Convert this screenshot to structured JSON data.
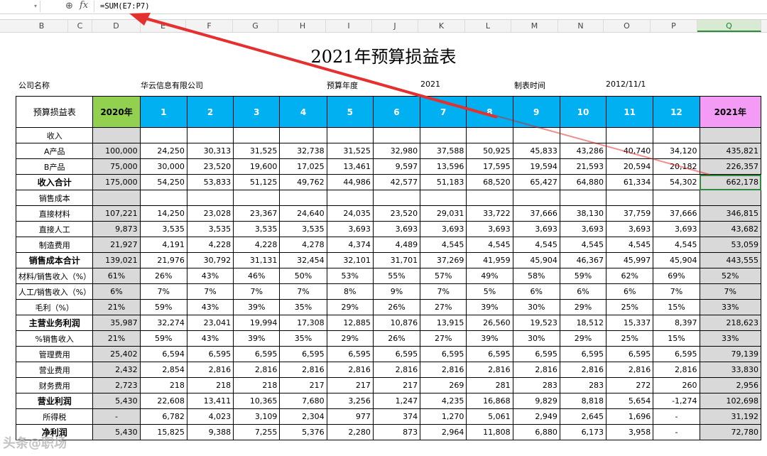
{
  "formula_bar": {
    "formula": "=SUM(E7:P7)"
  },
  "columns": [
    "B",
    "C",
    "D",
    "E",
    "F",
    "G",
    "H",
    "I",
    "J",
    "K",
    "L",
    "M",
    "N",
    "O",
    "P",
    "Q"
  ],
  "title": "2021年预算损益表",
  "info": {
    "company_label": "公司名称",
    "company_value": "华云信息有限公司",
    "year_label": "预算年度",
    "year_value": "2021",
    "date_label": "制表时间",
    "date_value": "2012/11/1"
  },
  "header": {
    "label": "预算损益表",
    "prev_year": "2020年",
    "months": [
      "1",
      "2",
      "3",
      "4",
      "5",
      "6",
      "7",
      "8",
      "9",
      "10",
      "11",
      "12"
    ],
    "next_year": "2021年"
  },
  "rows": [
    {
      "label": "收入",
      "bold": false,
      "values": [
        "",
        "",
        "",
        "",
        "",
        "",
        "",
        "",
        "",
        "",
        "",
        "",
        "",
        ""
      ]
    },
    {
      "label": "A产品",
      "bold": false,
      "values": [
        "100,000",
        "24,250",
        "30,313",
        "31,525",
        "32,738",
        "31,525",
        "32,980",
        "37,588",
        "50,925",
        "45,833",
        "43,286",
        "40,740",
        "34,120",
        "435,821"
      ]
    },
    {
      "label": "B产品",
      "bold": false,
      "values": [
        "75,000",
        "30,000",
        "23,520",
        "19,600",
        "17,025",
        "13,461",
        "9,597",
        "13,596",
        "17,595",
        "19,594",
        "21,593",
        "20,594",
        "20,182",
        "226,357"
      ]
    },
    {
      "label": "收入合计",
      "bold": true,
      "values": [
        "175,000",
        "54,250",
        "53,833",
        "51,125",
        "49,762",
        "44,986",
        "42,577",
        "51,183",
        "68,520",
        "65,427",
        "64,880",
        "61,334",
        "54,302",
        "662,178"
      ]
    },
    {
      "label": "销售成本",
      "bold": false,
      "values": [
        "",
        "",
        "",
        "",
        "",
        "",
        "",
        "",
        "",
        "",
        "",
        "",
        "",
        ""
      ]
    },
    {
      "label": "直接材料",
      "bold": false,
      "values": [
        "107,221",
        "14,250",
        "23,028",
        "23,367",
        "24,640",
        "24,035",
        "23,520",
        "29,031",
        "33,722",
        "37,666",
        "38,130",
        "37,759",
        "37,666",
        "346,815"
      ]
    },
    {
      "label": "直接人工",
      "bold": false,
      "values": [
        "9,873",
        "3,535",
        "3,535",
        "3,535",
        "3,535",
        "3,693",
        "3,693",
        "3,693",
        "3,693",
        "3,693",
        "3,693",
        "3,693",
        "3,693",
        "43,682"
      ]
    },
    {
      "label": "制造费用",
      "bold": false,
      "values": [
        "21,927",
        "4,191",
        "4,228",
        "4,228",
        "4,278",
        "4,374",
        "4,489",
        "4,545",
        "4,545",
        "4,545",
        "4,545",
        "4,545",
        "4,545",
        "53,059"
      ]
    },
    {
      "label": "销售成本合计",
      "bold": true,
      "values": [
        "139,021",
        "21,976",
        "30,792",
        "31,131",
        "32,454",
        "32,101",
        "31,701",
        "37,269",
        "41,959",
        "45,904",
        "46,367",
        "45,997",
        "45,904",
        "443,555"
      ]
    },
    {
      "label": "材料/销售收入（%）",
      "bold": false,
      "pct": true,
      "values": [
        "61%",
        "26%",
        "43%",
        "46%",
        "50%",
        "53%",
        "55%",
        "57%",
        "49%",
        "58%",
        "59%",
        "62%",
        "69%",
        "52%"
      ]
    },
    {
      "label": "人工/销售收入（%）",
      "bold": false,
      "pct": true,
      "values": [
        "6%",
        "7%",
        "7%",
        "7%",
        "7%",
        "8%",
        "9%",
        "7%",
        "5%",
        "6%",
        "6%",
        "6%",
        "7%",
        "7%"
      ]
    },
    {
      "label": "毛利（%）",
      "bold": false,
      "pct": true,
      "values": [
        "21%",
        "59%",
        "43%",
        "39%",
        "35%",
        "29%",
        "26%",
        "27%",
        "39%",
        "30%",
        "29%",
        "25%",
        "15%",
        "33%"
      ]
    },
    {
      "label": "主营业务利润",
      "bold": true,
      "values": [
        "35,987",
        "32,274",
        "23,041",
        "19,994",
        "17,308",
        "12,885",
        "10,876",
        "13,915",
        "26,560",
        "19,523",
        "18,512",
        "15,337",
        "8,397",
        "218,623"
      ]
    },
    {
      "label": "%销售收入",
      "bold": false,
      "pct": true,
      "values": [
        "21%",
        "59%",
        "43%",
        "39%",
        "35%",
        "29%",
        "26%",
        "27%",
        "39%",
        "30%",
        "29%",
        "25%",
        "15%",
        "33%"
      ]
    },
    {
      "label": "管理费用",
      "bold": false,
      "values": [
        "25,402",
        "6,594",
        "6,595",
        "6,595",
        "6,595",
        "6,595",
        "6,595",
        "6,595",
        "6,595",
        "6,595",
        "6,595",
        "6,595",
        "6,595",
        "79,139"
      ]
    },
    {
      "label": "营业费用",
      "bold": false,
      "values": [
        "2,432",
        "2,854",
        "2,816",
        "2,816",
        "2,816",
        "2,816",
        "2,816",
        "2,816",
        "2,816",
        "2,816",
        "2,816",
        "2,816",
        "2,816",
        "33,830"
      ]
    },
    {
      "label": "财务费用",
      "bold": false,
      "values": [
        "2,723",
        "218",
        "218",
        "218",
        "217",
        "217",
        "217",
        "269",
        "281",
        "283",
        "283",
        "272",
        "260",
        "2,956"
      ]
    },
    {
      "label": "营业利润",
      "bold": true,
      "values": [
        "5,430",
        "22,608",
        "13,411",
        "10,365",
        "7,680",
        "3,256",
        "1,247",
        "4,235",
        "16,868",
        "9,829",
        "8,818",
        "5,654",
        "-1,274",
        "102,698"
      ]
    },
    {
      "label": "所得税",
      "bold": false,
      "values": [
        "-",
        "6,782",
        "4,023",
        "3,109",
        "2,304",
        "977",
        "374",
        "1,270",
        "5,061",
        "2,949",
        "2,645",
        "1,696",
        "-",
        "31,192"
      ]
    },
    {
      "label": "净利润",
      "bold": true,
      "values": [
        "5,430",
        "15,825",
        "9,388",
        "7,255",
        "5,376",
        "2,280",
        "873",
        "2,964",
        "11,808",
        "6,880",
        "6,173",
        "3,958",
        "-",
        "72,780"
      ]
    }
  ],
  "watermark": "头条@职场"
}
